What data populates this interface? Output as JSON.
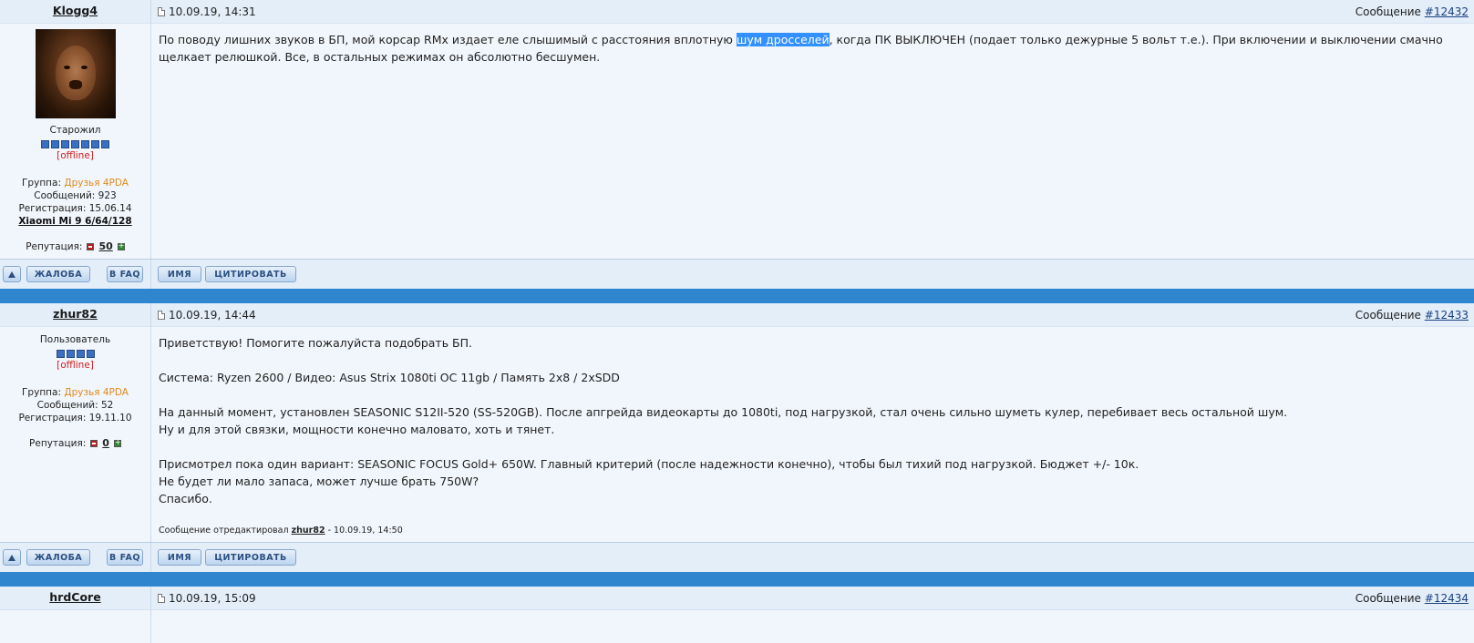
{
  "posts": [
    {
      "author": "Klogg4",
      "date": "10.09.19, 14:31",
      "msg_prefix": "Сообщение",
      "msg_num": "#12432",
      "rank": "Старожил",
      "pips": 7,
      "status": "[offline]",
      "group_label": "Группа:",
      "group": "Друзья 4PDA",
      "messages": "Сообщений: 923",
      "registration": "Регистрация: 15.06.14",
      "device": "Xiaomi Mi 9 6/64/128",
      "reputation_label": "Репутация:",
      "reputation": "50",
      "text_before_highlight": "По поводу лишних звуков в БП, мой корсар RMx издает еле слышимый с расстояния вплотную ",
      "highlight": "шум дросселей",
      "text_after_highlight": ", когда ПК ВЫКЛЮЧЕН (подает только дежурные 5 вольт т.е.). При включении и выключении смачно щелкает релюшкой. Все, в остальных режимах он абсолютно бесшумен."
    },
    {
      "author": "zhur82",
      "date": "10.09.19, 14:44",
      "msg_prefix": "Сообщение",
      "msg_num": "#12433",
      "rank": "Пользователь",
      "pips": 4,
      "status": "[offline]",
      "group_label": "Группа:",
      "group": "Друзья 4PDA",
      "messages": "Сообщений: 52",
      "registration": "Регистрация: 19.11.10",
      "reputation_label": "Репутация:",
      "reputation": "0",
      "lines": [
        "Приветствую! Помогите пожалуйста подобрать БП.",
        "",
        "Система: Ryzen 2600 / Видео: Asus Strix 1080ti OC 11gb / Память 2x8 / 2xSDD",
        "",
        "На данный момент, установлен SEASONIC S12II-520 (SS-520GB). После апгрейда видеокарты до 1080ti, под нагрузкой, стал очень сильно шуметь кулер, перебивает весь остальной шум.",
        "Ну и для этой связки, мощности конечно маловато, хоть и тянет.",
        "",
        "Присмотрел пока один вариант: SEASONIC FOCUS Gold+ 650W. Главный критерий (после надежности конечно), чтобы был тихий под нагрузкой. Бюджет +/- 10к.",
        "Не будет ли мало запаса, может лучше брать 750W?",
        "Спасибо."
      ],
      "edited_prefix": "Сообщение отредактировал",
      "edited_by": "zhur82",
      "edited_time": "- 10.09.19, 14:50"
    },
    {
      "author": "hrdCore",
      "date": "10.09.19, 15:09",
      "msg_prefix": "Сообщение",
      "msg_num": "#12434"
    }
  ],
  "buttons": {
    "complain": "ЖАЛОБА",
    "faq": "В FAQ",
    "name": "ИМЯ",
    "quote": "ЦИТИРОВАТЬ"
  },
  "colors": {
    "header_bg": "#e3eef9",
    "body_bg": "#f1f6fc",
    "separator": "#2f86cf",
    "group": "#e08a1a",
    "offline": "#d02020",
    "highlight": "#3390ff"
  }
}
